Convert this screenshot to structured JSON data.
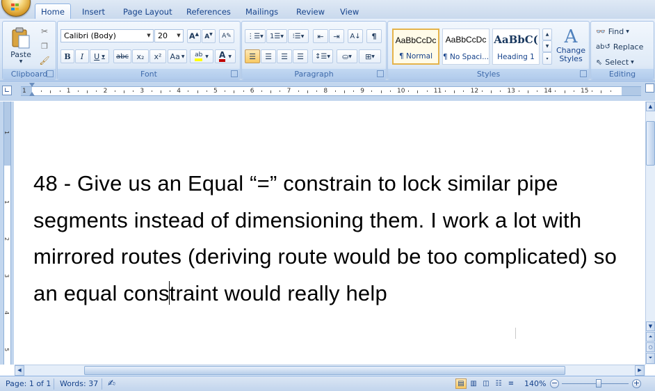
{
  "tabs": [
    "Home",
    "Insert",
    "Page Layout",
    "References",
    "Mailings",
    "Review",
    "View"
  ],
  "ribbon": {
    "clipboard": {
      "label": "Clipboard",
      "paste": "Paste"
    },
    "font": {
      "label": "Font",
      "font_name": "Calibri (Body)",
      "font_size": "20",
      "bold": "B",
      "italic": "I",
      "underline": "U",
      "strike": "abc",
      "subscript": "x₂",
      "superscript": "x²",
      "change_case": "Aa",
      "highlight": "ab",
      "font_color": "A"
    },
    "paragraph": {
      "label": "Paragraph"
    },
    "styles": {
      "label": "Styles",
      "tiles": [
        {
          "sample": "AaBbCcDc",
          "name": "¶ Normal"
        },
        {
          "sample": "AaBbCcDc",
          "name": "¶ No Spaci..."
        },
        {
          "sample": "AaBbC(",
          "name": "Heading 1"
        }
      ],
      "change_styles": "Change Styles"
    },
    "editing": {
      "label": "Editing",
      "find": "Find",
      "replace": "Replace",
      "select": "Select"
    }
  },
  "ruler": {
    "numbers": [
      "1",
      "1",
      "2",
      "3",
      "4",
      "5",
      "6",
      "7",
      "8",
      "9",
      "10",
      "11",
      "12",
      "13",
      "14",
      "15"
    ]
  },
  "vruler": {
    "numbers": [
      "1",
      "1",
      "2",
      "3",
      "4",
      "5"
    ]
  },
  "document": {
    "text_before_caret": "48 - Give us an Equal “=” constrain to lock similar pipe segments instead of dimensioning them. I work a lot with mirrored routes (deriving route would be too complicated) so an equal cons",
    "text_after_caret": "traint would really help"
  },
  "status": {
    "page": "Page: 1 of 1",
    "words": "Words: 37",
    "zoom": "140%",
    "zoom_level_percent": 140
  },
  "colors": {
    "accent": "#15428b",
    "ribbon_bg": "#dfeaf7",
    "selected_style": "#e5b34a"
  }
}
